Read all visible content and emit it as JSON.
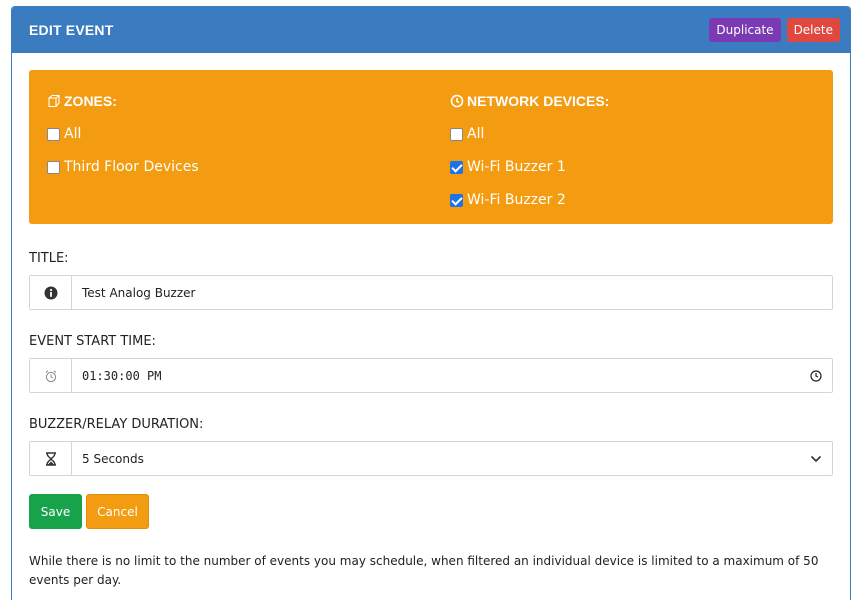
{
  "panel": {
    "title": "EDIT EVENT",
    "duplicate_label": "Duplicate",
    "delete_label": "Delete"
  },
  "zones": {
    "heading": "ZONES:",
    "items": [
      {
        "label": "All",
        "checked": false
      },
      {
        "label": "Third Floor Devices",
        "checked": false
      }
    ]
  },
  "devices": {
    "heading": "NETWORK DEVICES:",
    "items": [
      {
        "label": "All",
        "checked": false
      },
      {
        "label": "Wi-Fi Buzzer 1",
        "checked": true
      },
      {
        "label": "Wi-Fi Buzzer 2",
        "checked": true
      }
    ]
  },
  "form": {
    "title_label": "TITLE:",
    "title_value": "Test Analog Buzzer",
    "start_label": "EVENT START TIME:",
    "start_value": "01:30:00 PM",
    "duration_label": "BUZZER/RELAY DURATION:",
    "duration_value": "5 Seconds"
  },
  "actions": {
    "save_label": "Save",
    "cancel_label": "Cancel"
  },
  "note": "While there is no limit to the number of events you may schedule, when filtered an individual device is limited to a maximum of 50 events per day.",
  "icons": {
    "zones": "cube-icon",
    "devices": "circle-exclamation-icon",
    "title": "info-icon",
    "start": "alarm-clock-icon",
    "duration": "hourglass-icon",
    "time_picker": "clock-icon",
    "select": "chevron-down-icon"
  },
  "colors": {
    "header": "#3a7cbf",
    "duplicate": "#7b3ab3",
    "delete": "#e0473e",
    "selector": "#f39c12",
    "save": "#17a34a",
    "cancel": "#f39c12"
  }
}
